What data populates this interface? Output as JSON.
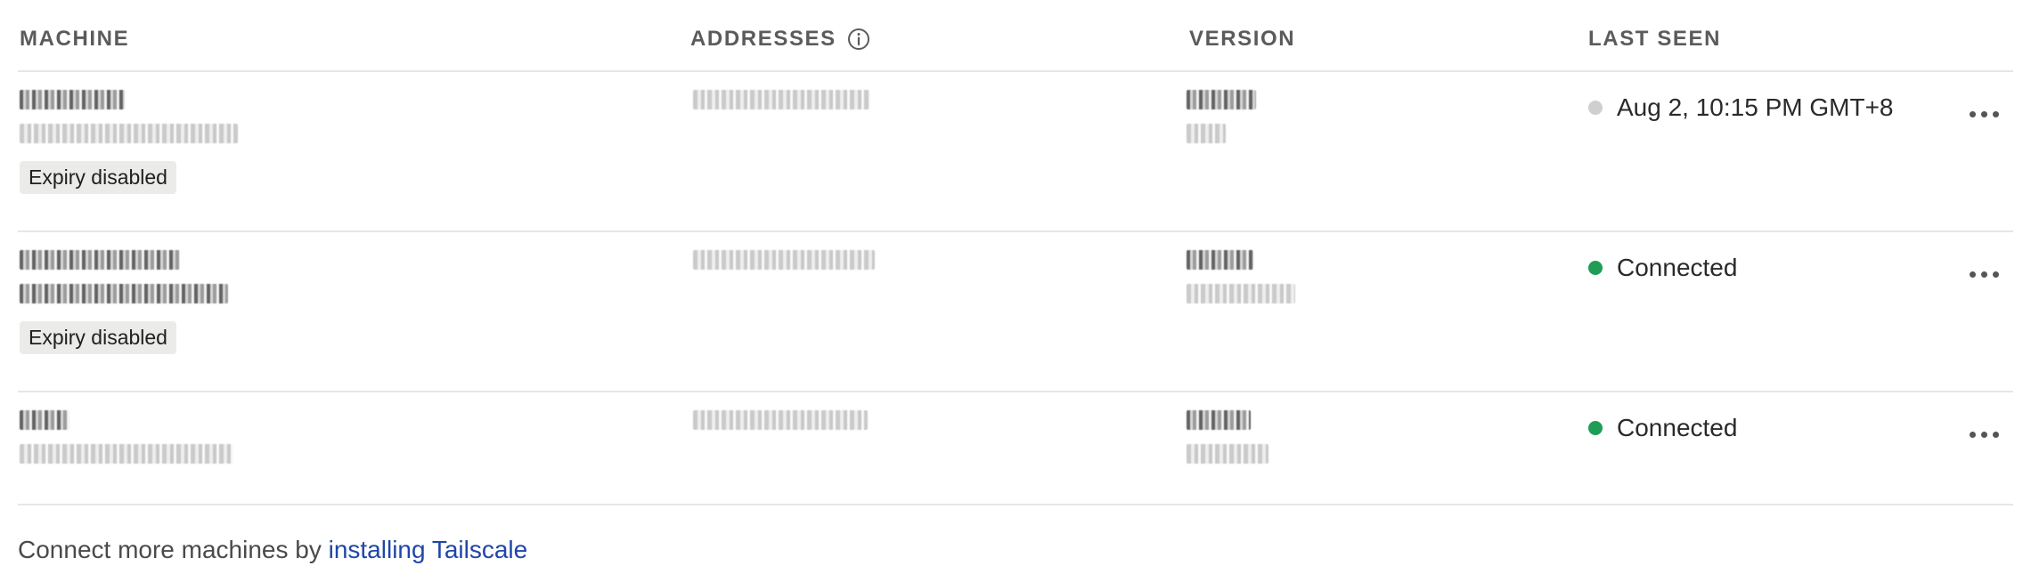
{
  "table": {
    "columns": {
      "machine": "MACHINE",
      "addresses": "ADDRESSES",
      "version": "VERSION",
      "last_seen": "LAST SEEN"
    },
    "addresses_info_icon": "info-icon",
    "rows": [
      {
        "badge": "Expiry disabled",
        "last_seen": "Aug 2, 10:15 PM GMT+8",
        "status_color": "#cfcfcf",
        "menu_icon": "more-horizontal-icon"
      },
      {
        "badge": "Expiry disabled",
        "last_seen": "Connected",
        "status_color": "#1f9d55",
        "menu_icon": "more-horizontal-icon"
      },
      {
        "badge": "",
        "last_seen": "Connected",
        "status_color": "#1f9d55",
        "menu_icon": "more-horizontal-icon"
      }
    ]
  },
  "footer": {
    "text": "Connect more machines by ",
    "link": "installing Tailscale"
  },
  "colors": {
    "connected": "#1f9d55",
    "offline": "#cfcfcf",
    "link": "#1f46a8"
  }
}
